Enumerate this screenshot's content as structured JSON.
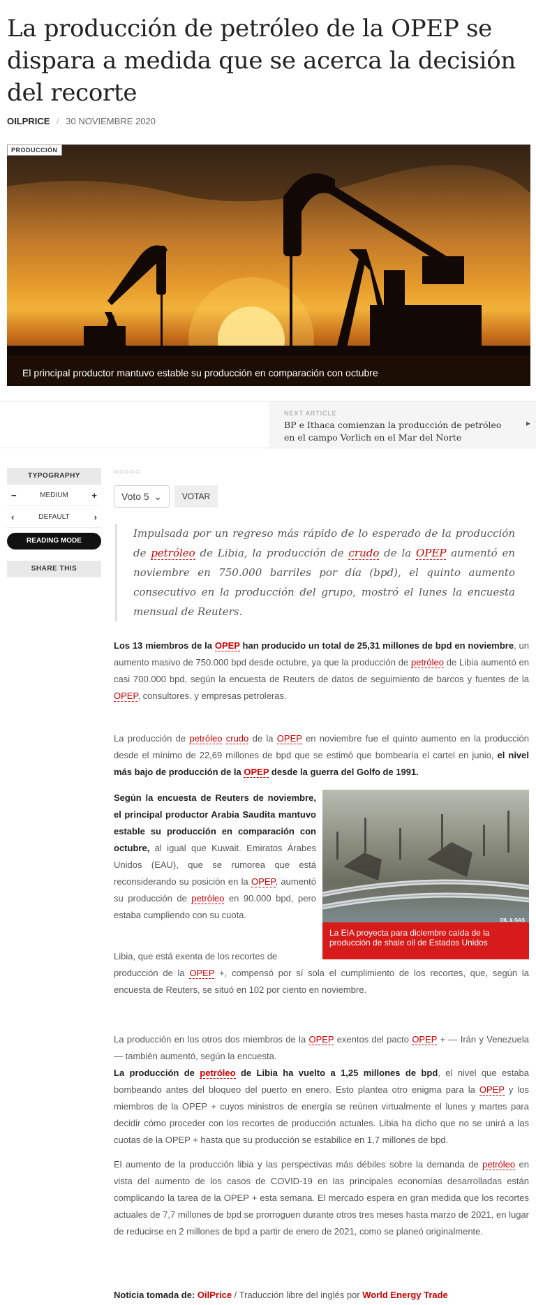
{
  "article": {
    "title": "La producción de petróleo de la OPEP se dispara a medida que se acerca la decisión del recorte",
    "author": "OILPRICE",
    "date": "30 NOVIEMBRE 2020",
    "category_badge": "PRODUCCIÓN",
    "hero_caption": "El principal productor mantuvo estable su producción en comparación con octubre"
  },
  "next_article": {
    "label": "NEXT ARTICLE",
    "title": "BP e Ithaca comienzan la producción de petróleo en el campo Vorlich en el Mar del Norte"
  },
  "sidebar": {
    "typography": "TYPOGRAPHY",
    "size_label": "MEDIUM",
    "font_label": "DEFAULT",
    "reading_mode": "READING MODE",
    "share": "SHARE THIS",
    "minus": "−",
    "plus": "+",
    "prev": "‹",
    "next": "›"
  },
  "rating": {
    "stars": "○○○○○",
    "selected": "Voto 5",
    "vote_button": "VOTAR"
  },
  "inline_photo": {
    "tag": "OIL & GAS",
    "caption": "La EIA proyecta para diciembre caída de la producción de shale oil de Estados Unidos"
  },
  "source": {
    "prefix": "Noticia tomada de:",
    "outlet": "OilPrice",
    "middle": " / Traducción libre del inglés por ",
    "translator": "World Energy Trade"
  },
  "colors": {
    "accent": "#cc0000",
    "caption_bg": "#d71b1b"
  }
}
